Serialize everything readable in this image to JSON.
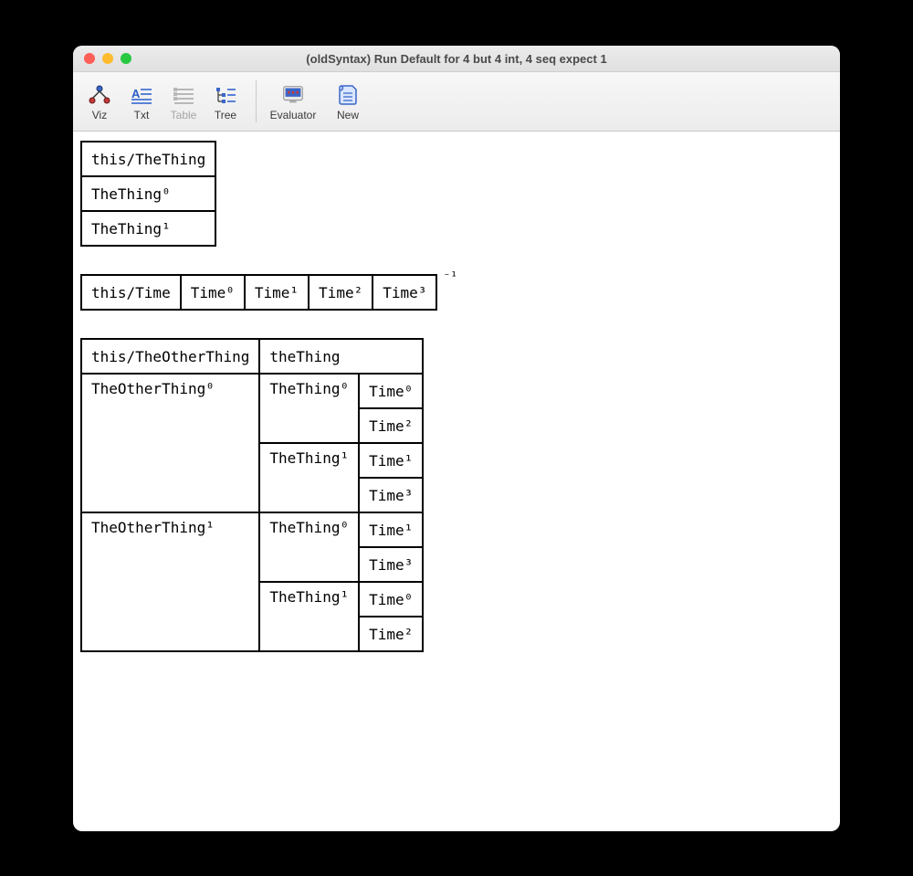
{
  "window": {
    "title": "(oldSyntax) Run Default for 4 but 4 int, 4 seq expect 1"
  },
  "toolbar": {
    "viz": "Viz",
    "txt": "Txt",
    "table": "Table",
    "tree": "Tree",
    "evaluator": "Evaluator",
    "new": "New"
  },
  "tables": {
    "theThing": {
      "header": "this/TheThing",
      "rows": [
        "TheThing⁰",
        "TheThing¹"
      ]
    },
    "time": {
      "header": "this/Time",
      "cells": [
        "Time⁰",
        "Time¹",
        "Time²",
        "Time³"
      ],
      "annotation": "⁻¹"
    },
    "theOtherThing": {
      "headers": [
        "this/TheOtherThing",
        "theThing"
      ],
      "r0c0": "TheOtherThing⁰",
      "r0c1": "TheThing⁰",
      "r0c2": "Time⁰",
      "r1c2": "Time²",
      "r2c1": "TheThing¹",
      "r2c2": "Time¹",
      "r3c2": "Time³",
      "r4c0": "TheOtherThing¹",
      "r4c1": "TheThing⁰",
      "r4c2": "Time¹",
      "r5c2": "Time³",
      "r6c1": "TheThing¹",
      "r6c2": "Time⁰",
      "r7c2": "Time²"
    }
  }
}
